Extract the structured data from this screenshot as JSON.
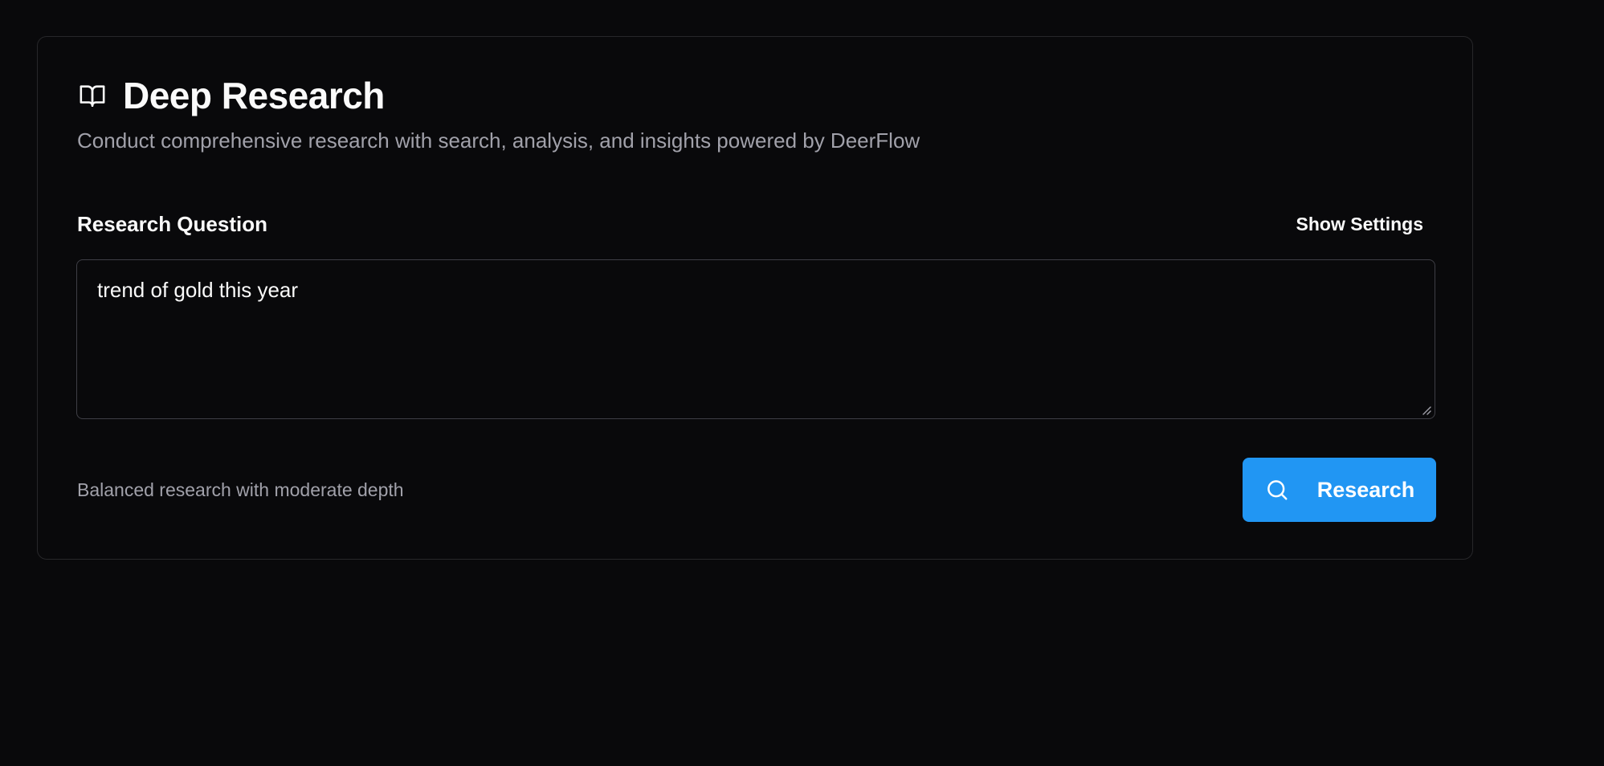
{
  "header": {
    "icon": "book-open-icon",
    "title": "Deep Research",
    "subtitle": "Conduct comprehensive research with search, analysis, and insights powered by DeerFlow"
  },
  "form": {
    "question_label": "Research Question",
    "settings_label": "Show Settings",
    "question_value": "trend of gold this year",
    "depth_description": "Balanced research with moderate depth",
    "submit_label": "Research",
    "submit_icon": "search-icon"
  },
  "colors": {
    "background": "#09090b",
    "accent": "#2196f3",
    "muted_text": "#a1a1aa",
    "border": "#27272a"
  }
}
